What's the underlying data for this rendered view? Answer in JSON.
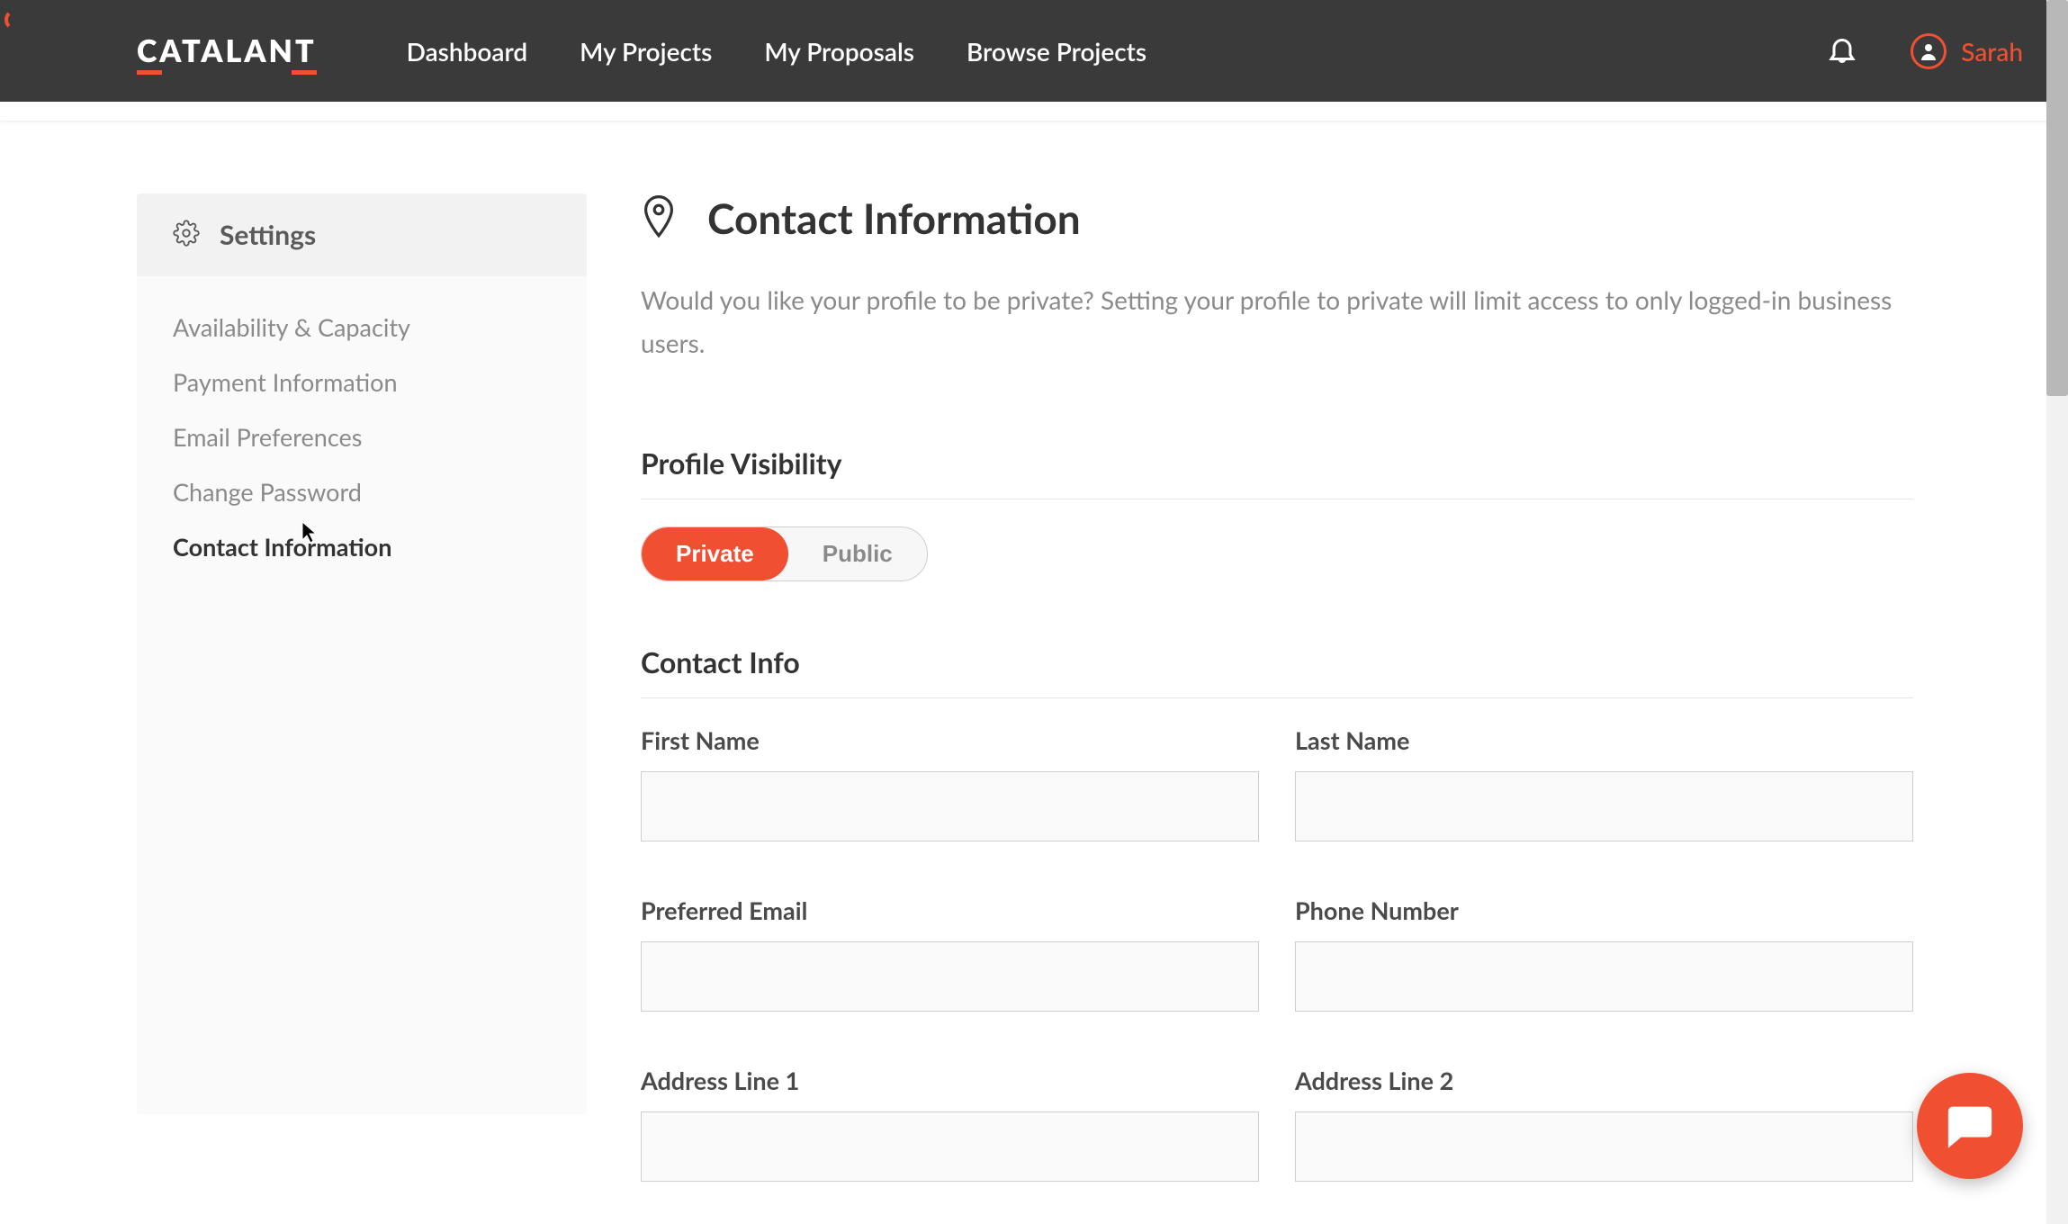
{
  "header": {
    "logo": "CATALANT",
    "nav": [
      "Dashboard",
      "My Projects",
      "My Proposals",
      "Browse Projects"
    ],
    "user_name": "Sarah"
  },
  "sidebar": {
    "title": "Settings",
    "items": [
      {
        "label": "Availability & Capacity",
        "active": false
      },
      {
        "label": "Payment Information",
        "active": false
      },
      {
        "label": "Email Preferences",
        "active": false
      },
      {
        "label": "Change Password",
        "active": false
      },
      {
        "label": "Contact Information",
        "active": true
      }
    ]
  },
  "main": {
    "title": "Contact Information",
    "description": "Would you like your profile to be private? Setting your profile to private will limit access to only logged-in business users.",
    "visibility": {
      "section_title": "Profile Visibility",
      "options": [
        "Private",
        "Public"
      ],
      "active_index": 0
    },
    "contact": {
      "section_title": "Contact Info",
      "fields": [
        {
          "label": "First Name",
          "value": ""
        },
        {
          "label": "Last Name",
          "value": ""
        },
        {
          "label": "Preferred Email",
          "value": ""
        },
        {
          "label": "Phone Number",
          "value": ""
        },
        {
          "label": "Address Line 1",
          "value": ""
        },
        {
          "label": "Address Line 2",
          "value": ""
        }
      ]
    }
  },
  "colors": {
    "accent": "#F04F32",
    "header_bg": "#3A3A3A"
  }
}
